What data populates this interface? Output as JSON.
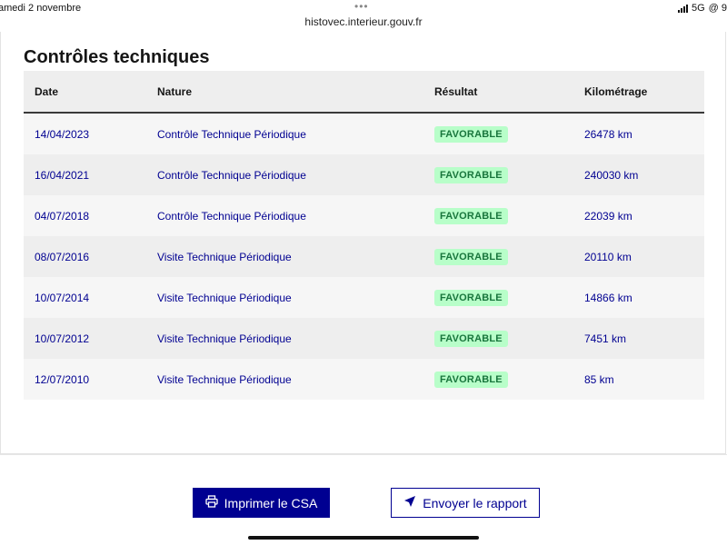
{
  "status_bar": {
    "date": "amedi 2 novembre",
    "url": "histovec.interieur.gouv.fr",
    "network": "5G",
    "extra": "@ 9"
  },
  "section": {
    "title": "Contrôles techniques"
  },
  "table": {
    "headers": {
      "date": "Date",
      "nature": "Nature",
      "result": "Résultat",
      "mileage": "Kilométrage"
    },
    "rows": [
      {
        "date": "14/04/2023",
        "nature": "Contrôle Technique Périodique",
        "result": "FAVORABLE",
        "mileage": "26478 km"
      },
      {
        "date": "16/04/2021",
        "nature": "Contrôle Technique Périodique",
        "result": "FAVORABLE",
        "mileage": "240030 km"
      },
      {
        "date": "04/07/2018",
        "nature": "Contrôle Technique Périodique",
        "result": "FAVORABLE",
        "mileage": "22039 km"
      },
      {
        "date": "08/07/2016",
        "nature": "Visite Technique Périodique",
        "result": "FAVORABLE",
        "mileage": "20110 km"
      },
      {
        "date": "10/07/2014",
        "nature": "Visite Technique Périodique",
        "result": "FAVORABLE",
        "mileage": "14866 km"
      },
      {
        "date": "10/07/2012",
        "nature": "Visite Technique Périodique",
        "result": "FAVORABLE",
        "mileage": "7451 km"
      },
      {
        "date": "12/07/2010",
        "nature": "Visite Technique Périodique",
        "result": "FAVORABLE",
        "mileage": "85 km"
      }
    ]
  },
  "actions": {
    "print_label": "Imprimer le CSA",
    "print_icon": "printer-icon",
    "send_label": "Envoyer le rapport",
    "send_icon": "send-arrow-icon"
  },
  "colors": {
    "primary": "#000091",
    "badge_bg": "#b8fec9",
    "badge_text": "#18753c"
  }
}
